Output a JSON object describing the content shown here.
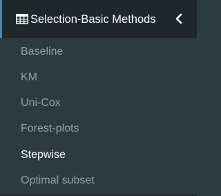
{
  "header": {
    "icon": "table-grid-icon",
    "title": "Selection-Basic Methods",
    "toggle_icon": "chevron-left-icon"
  },
  "submenu": {
    "items": [
      {
        "label": "Baseline"
      },
      {
        "label": "KM"
      },
      {
        "label": "Uni-Cox"
      },
      {
        "label": "Forest-plots"
      },
      {
        "label": "Stepwise",
        "active": true
      },
      {
        "label": "Optimal subset"
      }
    ]
  },
  "colors": {
    "background": "#2c3b41",
    "header_background": "#1e282c",
    "accent": "#3c8dbc",
    "item_text": "#8aa4af",
    "active_text": "#ffffff"
  }
}
